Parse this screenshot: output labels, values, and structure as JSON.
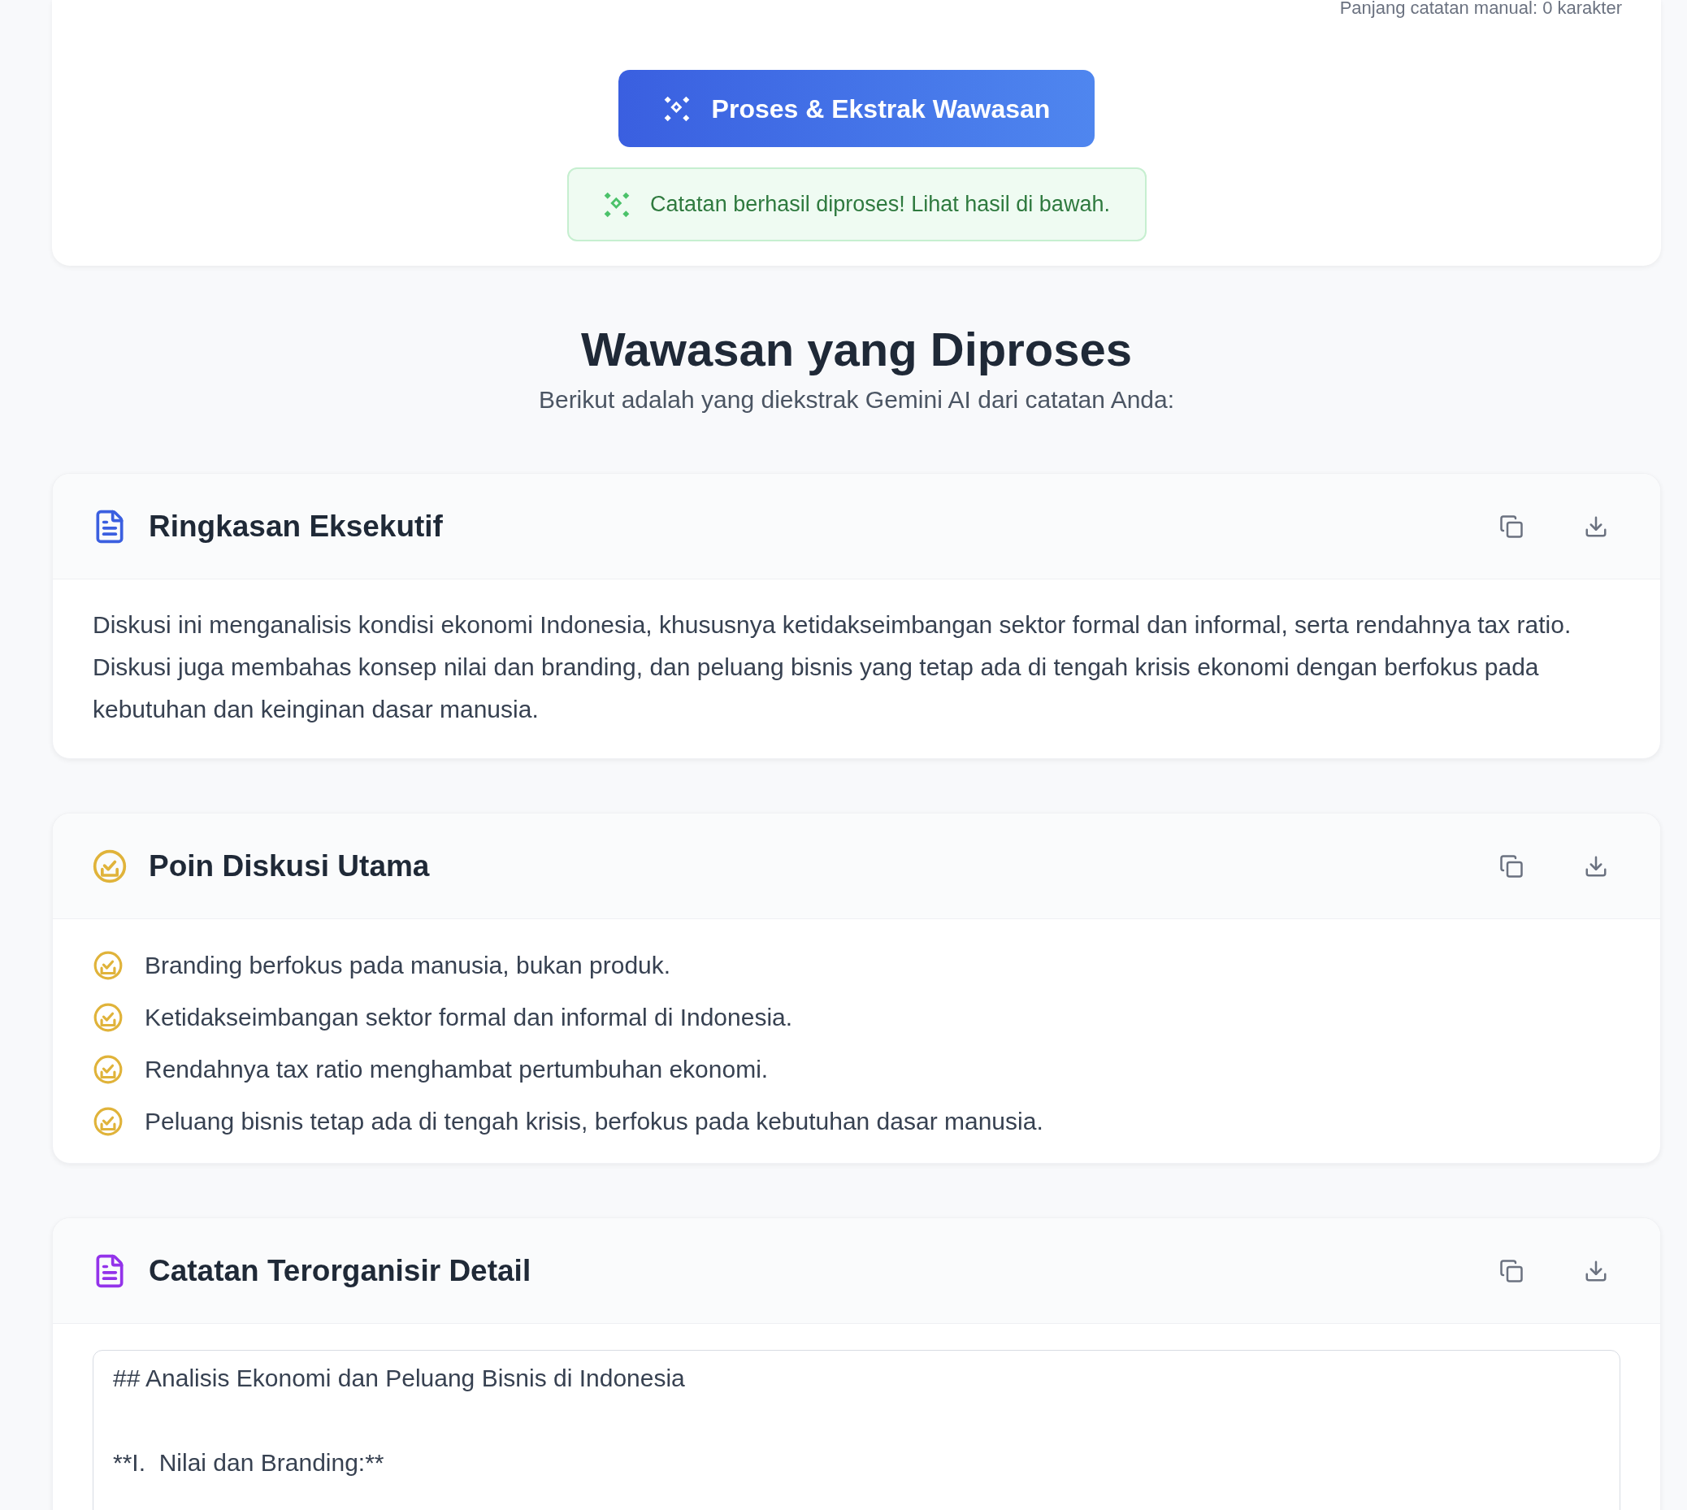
{
  "input_card": {
    "char_count": "Panjang catatan manual: 0 karakter",
    "process_button": "Proses & Ekstrak Wawasan",
    "success_message": "Catatan berhasil diproses! Lihat hasil di bawah."
  },
  "results": {
    "title": "Wawasan yang Diproses",
    "subtitle": "Berikut adalah yang diekstrak Gemini AI dari catatan Anda:"
  },
  "sections": [
    {
      "kind": "paragraph",
      "color": "#3b5fe0",
      "title": "Ringkasan Eksekutif",
      "text": "Diskusi ini menganalisis kondisi ekonomi Indonesia, khususnya ketidakseimbangan sektor formal dan informal, serta rendahnya tax ratio. Diskusi juga membahas konsep nilai dan branding, dan peluang bisnis yang tetap ada di tengah krisis ekonomi dengan berfokus pada kebutuhan dan keinginan dasar manusia."
    },
    {
      "kind": "list",
      "color": "#e0b33a",
      "title": "Poin Diskusi Utama",
      "items": [
        "Branding berfokus pada manusia, bukan produk.",
        "Ketidakseimbangan sektor formal dan informal di Indonesia.",
        "Rendahnya tax ratio menghambat pertumbuhan ekonomi.",
        "Peluang bisnis tetap ada di tengah krisis, berfokus pada kebutuhan dasar manusia."
      ]
    },
    {
      "kind": "notes",
      "color": "#9333ea",
      "title": "Catatan Terorganisir Detail",
      "text": "## Analisis Ekonomi dan Peluang Bisnis di Indonesia\n\n**I.  Nilai dan Branding:**"
    }
  ]
}
